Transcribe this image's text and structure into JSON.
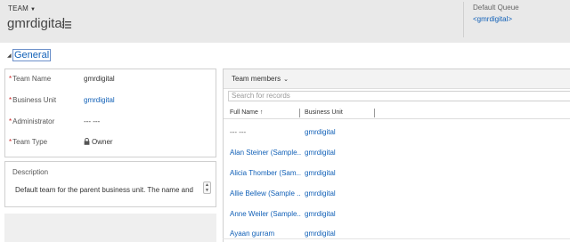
{
  "header": {
    "entity_type": "TEAM",
    "record_title": "gmrdigital",
    "queue_label": "Default Queue",
    "queue_value": "<gmrdigital>"
  },
  "section": {
    "title": "General"
  },
  "form": {
    "fields": [
      {
        "label": "Team Name",
        "value": "gmrdigital",
        "required": true
      },
      {
        "label": "Business Unit",
        "value": "gmrdigital",
        "required": true
      },
      {
        "label": "Administrator",
        "value": "--- ---",
        "required": true
      },
      {
        "label": "Team Type",
        "value": "Owner",
        "required": true
      }
    ],
    "description_label": "Description",
    "description_text": "Default team for the parent business unit. The name and"
  },
  "grid": {
    "title": "Team members",
    "search_placeholder": "Search for records",
    "columns": [
      "Full Name ↑",
      "Business Unit"
    ],
    "rows": [
      {
        "name": "--- ---",
        "bu": "gmrdigital"
      },
      {
        "name": "Alan Steiner (Sample...",
        "bu": "gmrdigital"
      },
      {
        "name": "Alicia Thomber (Sam...",
        "bu": "gmrdigital"
      },
      {
        "name": "Allie Bellew (Sample ...",
        "bu": "gmrdigital"
      },
      {
        "name": "Anne Weiler (Sample...",
        "bu": "gmrdigital"
      },
      {
        "name": "Ayaan gurram",
        "bu": "gmrdigital"
      }
    ]
  },
  "icons": {
    "entity_caret": "caret-down-icon",
    "title_menu": "list-icon",
    "section_toggle": "triangle-icon",
    "lock": "lock-icon",
    "grid_chevron": "chevron-down-icon",
    "spinner": "spinner-icon"
  },
  "colors": {
    "link": "#1160b7",
    "header_bg": "#e9e9e9",
    "required": "#cc2222"
  }
}
